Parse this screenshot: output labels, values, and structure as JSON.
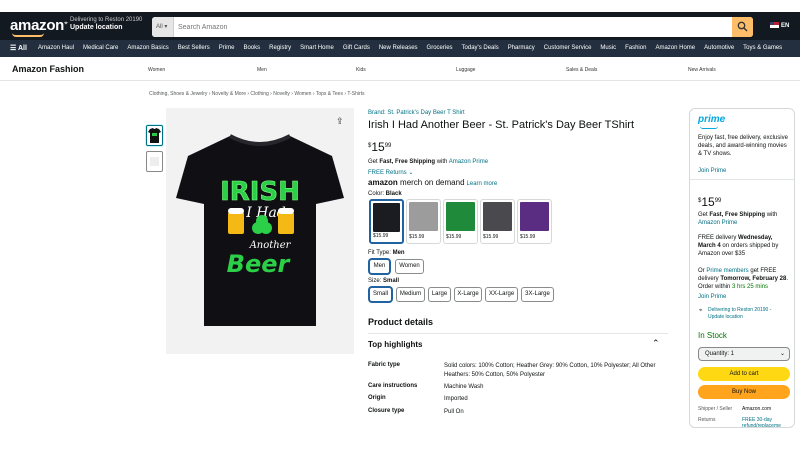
{
  "header": {
    "logo": "amazon",
    "deliver_line1": "Delivering to Reston 20190",
    "deliver_line2": "Update location",
    "search_category": "All",
    "search_placeholder": "Search Amazon",
    "language": "EN"
  },
  "subnav": {
    "all_label": "All",
    "items": [
      "Amazon Haul",
      "Medical Care",
      "Amazon Basics",
      "Best Sellers",
      "Prime",
      "Books",
      "Registry",
      "Smart Home",
      "Gift Cards",
      "New Releases",
      "Groceries",
      "Today's Deals",
      "Pharmacy",
      "Customer Service",
      "Music",
      "Fashion",
      "Amazon Home",
      "Automotive",
      "Toys & Games"
    ]
  },
  "fashion_nav": {
    "title": "Amazon Fashion",
    "items": [
      "Women",
      "Men",
      "Kids",
      "Luggage",
      "Sales & Deals",
      "New Arrivals"
    ]
  },
  "breadcrumb": "Clothing, Shoes & Jewelry › Novelty & More › Clothing › Novelty › Women › Tops & Tees › T-Shirts",
  "product": {
    "brand": "Brand: St. Patrick's Day Beer T Shirt",
    "title": "Irish I Had Another Beer - St. Patrick's Day Beer TShirt",
    "price_currency": "$",
    "price_whole": "15",
    "price_cents": "99",
    "free_shipping_prefix": "Get ",
    "free_shipping_bold": "Fast, Free Shipping",
    "free_shipping_with": " with ",
    "free_shipping_link": "Amazon Prime",
    "free_returns": "FREE Returns",
    "merch_logo": "amazon",
    "merch_text": "merch on demand",
    "learn_more": "Learn more",
    "color_label": "Color: ",
    "color_value": "Black",
    "colors": [
      {
        "name": "Black",
        "hex": "#1b1b22",
        "price": "$15.99"
      },
      {
        "name": "Heather Grey",
        "hex": "#9c9c9c",
        "price": "$15.99"
      },
      {
        "name": "Kelly Green",
        "hex": "#1f8a3a",
        "price": "$15.99"
      },
      {
        "name": "Asphalt",
        "hex": "#4a4a4e",
        "price": "$15.99"
      },
      {
        "name": "Purple",
        "hex": "#5a2d82",
        "price": "$15.99"
      }
    ],
    "fit_label": "Fit Type: ",
    "fit_value": "Men",
    "fits": [
      "Men",
      "Women"
    ],
    "size_label": "Size: ",
    "size_value": "Small",
    "sizes": [
      "Small",
      "Medium",
      "Large",
      "X-Large",
      "XX-Large",
      "3X-Large"
    ],
    "shirt_text": {
      "irish": "IRISH",
      "ihad": "I Had",
      "another": "Another",
      "beer": "Beer"
    }
  },
  "details": {
    "heading": "Product details",
    "highlights_heading": "Top highlights",
    "rows": [
      {
        "k": "Fabric type",
        "v": "Solid colors: 100% Cotton; Heather Grey: 90% Cotton, 10% Polyester; All Other Heathers: 50% Cotton, 50% Polyester"
      },
      {
        "k": "Care instructions",
        "v": "Machine Wash"
      },
      {
        "k": "Origin",
        "v": "Imported"
      },
      {
        "k": "Closure type",
        "v": "Pull On"
      }
    ]
  },
  "buybox": {
    "prime": "prime",
    "prime_blurb": "Enjoy fast, free delivery, exclusive deals, and award-winning movies & TV shows.",
    "join_prime": "Join Prime",
    "price_currency": "$",
    "price_whole": "15",
    "price_cents": "99",
    "fast_prefix": "Get ",
    "fast_bold": "Fast, Free Shipping",
    "fast_with": " with",
    "fast_link": "Amazon Prime",
    "delivery_prefix": "FREE delivery ",
    "delivery_date": "Wednesday, March 4",
    "delivery_suffix": " on orders shipped by Amazon over $35",
    "or_text": "Or ",
    "prime_members": "Prime members",
    "fastest_text": " get FREE delivery ",
    "fastest_date": "Tomorrow, February 28",
    "order_within": ". Order within ",
    "countdown": "3 hrs 25 mins",
    "join_prime2": "Join Prime",
    "deliver_to": "Delivering to Reston 20190 - Update location",
    "stock": "In Stock",
    "quantity": "Quantity: 1",
    "add_to_cart": "Add to cart",
    "buy_now": "Buy Now",
    "ships_from_k": "Shipper / Seller",
    "ships_from_v": "Amazon.com",
    "returns_k": "Returns",
    "returns_v": "FREE 30-day refund/replaceme"
  },
  "colors": {
    "nav_dark": "#131921",
    "nav_sub": "#232f3e",
    "accent_orange": "#febd69",
    "link": "#007185",
    "cart_yellow": "#ffd814",
    "buy_orange": "#ffa41c",
    "instock_green": "#007600"
  }
}
